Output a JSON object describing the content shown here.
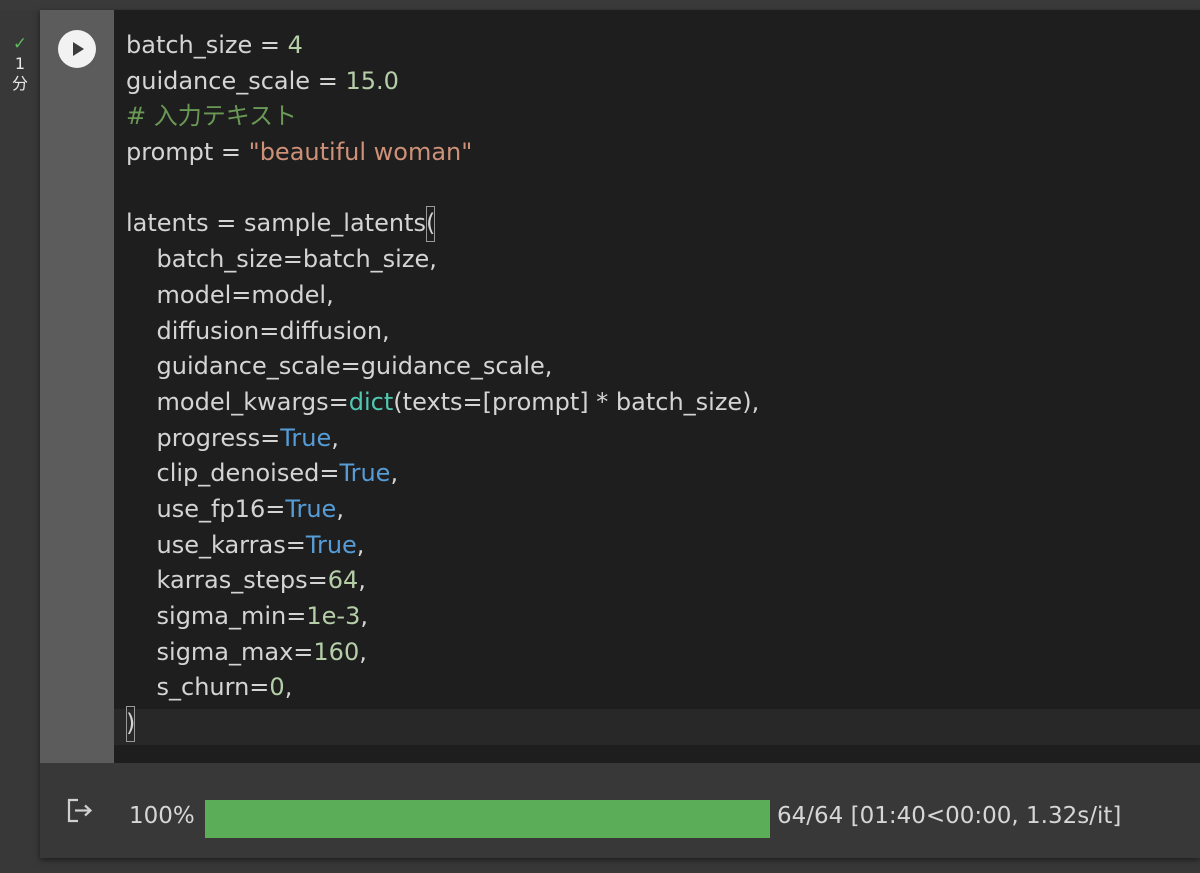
{
  "execution": {
    "status_icon": "check-icon",
    "duration_number": "1",
    "duration_unit": "分"
  },
  "code_lines": [
    "batch_size = 4",
    "guidance_scale = 15.0",
    "# 入力テキスト",
    "prompt = \"beautiful woman\"",
    "",
    "latents = sample_latents(",
    "    batch_size=batch_size,",
    "    model=model,",
    "    diffusion=diffusion,",
    "    guidance_scale=guidance_scale,",
    "    model_kwargs=dict(texts=[prompt] * batch_size),",
    "    progress=True,",
    "    clip_denoised=True,",
    "    use_fp16=True,",
    "    use_karras=True,",
    "    karras_steps=64,",
    "    sigma_min=1e-3,",
    "    sigma_max=160,",
    "    s_churn=0,",
    ")"
  ],
  "output": {
    "icon": "output-redirect-icon",
    "progress_percent_label": "100%",
    "progress_fraction": 1.0,
    "progress_stats": "64/64 [01:40<00:00, 1.32s/it]"
  },
  "colors": {
    "keyword": "#569cd6",
    "number": "#b5cea8",
    "string": "#ce9178",
    "comment": "#6a9955",
    "builtin": "#4ec9b0",
    "progress_fill": "#5cad57",
    "status_check": "#5cb85c"
  }
}
